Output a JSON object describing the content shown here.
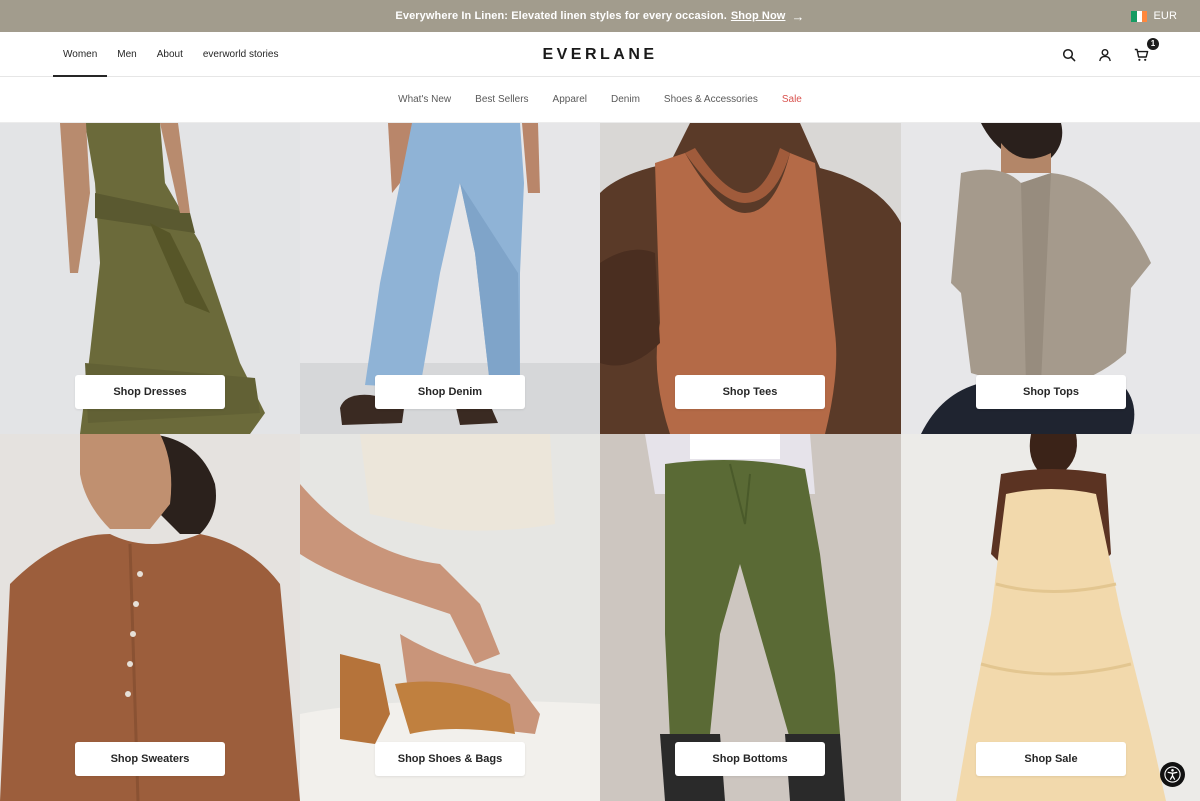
{
  "promo": {
    "text": "Everywhere In Linen: Elevated linen styles for every occasion.",
    "link": "Shop Now",
    "arrow_icon": "arrow-right-icon",
    "background": "#a29c8d"
  },
  "currency": {
    "label": "EUR",
    "flag_icon": "ireland-flag-icon",
    "flag_colors": [
      "#169b62",
      "#ffffff",
      "#ff883e"
    ]
  },
  "gender_nav": [
    {
      "label": "Women",
      "active": true
    },
    {
      "label": "Men",
      "active": false
    },
    {
      "label": "About",
      "active": false
    },
    {
      "label": "everworld stories",
      "active": false
    }
  ],
  "logo": "EVERLANE",
  "utility": {
    "search_icon": "search-icon",
    "account_icon": "user-icon",
    "cart_icon": "cart-icon",
    "cart_count": "1"
  },
  "category_nav": [
    {
      "label": "What's New"
    },
    {
      "label": "Best Sellers"
    },
    {
      "label": "Apparel"
    },
    {
      "label": "Denim"
    },
    {
      "label": "Shoes & Accessories"
    },
    {
      "label": "Sale",
      "accent": "#d9534f"
    }
  ],
  "tiles": [
    {
      "label": "Shop Dresses"
    },
    {
      "label": "Shop Denim"
    },
    {
      "label": "Shop Tees"
    },
    {
      "label": "Shop Tops"
    },
    {
      "label": "Shop Sweaters"
    },
    {
      "label": "Shop Shoes & Bags"
    },
    {
      "label": "Shop Bottoms"
    },
    {
      "label": "Shop Sale"
    }
  ],
  "accessibility_icon": "accessibility-icon"
}
